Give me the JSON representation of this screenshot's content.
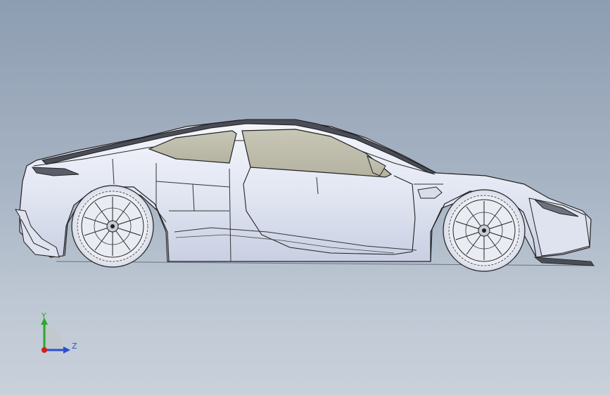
{
  "viewport": {
    "background_top": "#8d9db1",
    "background_bottom": "#c9d1db",
    "model": "car-side-view"
  },
  "triad": {
    "y_label": "Y",
    "z_label": "Z",
    "y_color": "#2aa82a",
    "z_color": "#2a4fd0",
    "x_color": "#d02020"
  }
}
